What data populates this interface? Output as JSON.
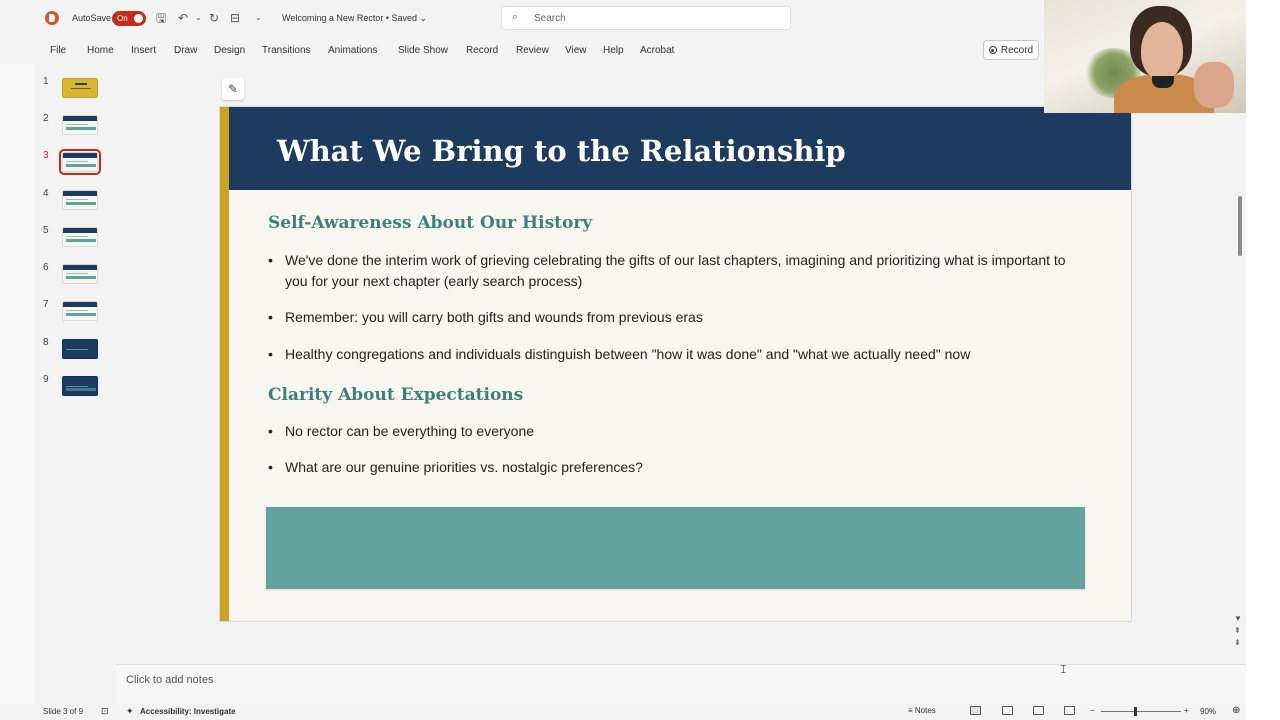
{
  "titlebar": {
    "autosave_label": "AutoSave",
    "autosave_state": "On",
    "doc_title": "Welcoming a New Rector • Saved ⌄",
    "search_placeholder": "Search"
  },
  "menu": {
    "items": [
      "File",
      "Home",
      "Insert",
      "Draw",
      "Design",
      "Transitions",
      "Animations",
      "Slide Show",
      "Record",
      "Review",
      "View",
      "Help",
      "Acrobat"
    ],
    "record_button": "Record"
  },
  "thumbnails": {
    "numbers": [
      "1",
      "2",
      "3",
      "4",
      "5",
      "6",
      "7",
      "8",
      "9"
    ],
    "selected": "3"
  },
  "slide": {
    "title": "What We Bring to the Relationship",
    "section1_heading": "Self-Awareness About Our History",
    "section1_bullets": [
      "We've done the interim work of grieving celebrating the gifts of our last chapters, imagining and prioritizing what is important to you for your next chapter (early search process)",
      "Remember: you will carry both gifts and wounds from previous eras",
      "Healthy congregations and individuals distinguish between \"how it was done\" and \"what we actually need\" now"
    ],
    "section2_heading": "Clarity About Expectations",
    "section2_bullets": [
      "No rector can be everything to everyone",
      "What are our genuine priorities vs. nostalgic preferences?"
    ],
    "colors": {
      "header": "#1d3a5f",
      "gold_accent": "#c9a424",
      "heading_teal": "#3d7f79",
      "box_teal": "#62a49d"
    }
  },
  "notes": {
    "placeholder": "Click to add notes"
  },
  "status": {
    "slide_counter": "Slide 3 of 9",
    "accessibility": "Accessibility: Investigate",
    "notes_button": "Notes",
    "zoom_minus": "−",
    "zoom_plus": "+",
    "zoom_percent": "90%"
  }
}
